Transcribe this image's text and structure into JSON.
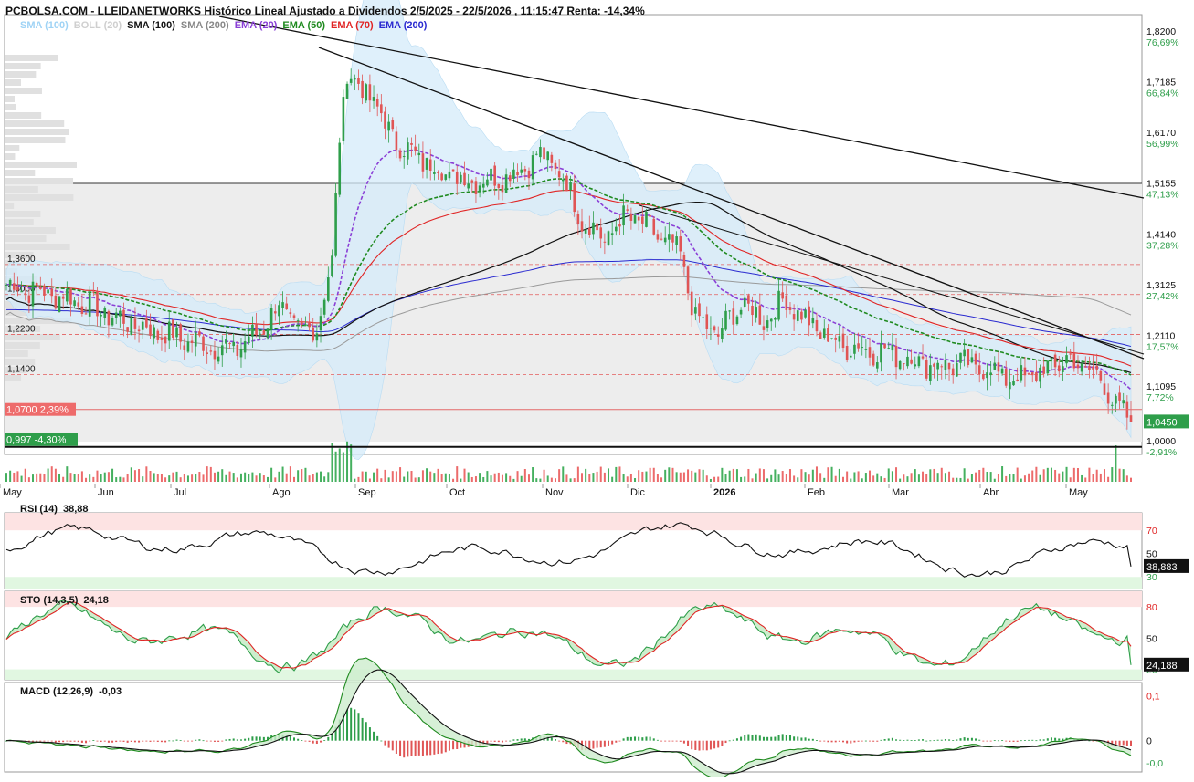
{
  "header": {
    "title": "PCBOLSA.COM - LLEIDANETWORKS Histórico Lineal Ajustado a Dividendos 2/5/2025 - 22/5/2026 , 11:15:47 Renta: -14,34%"
  },
  "legend": [
    {
      "label": "SMA (100)",
      "color": "#9fd3f5"
    },
    {
      "label": "BOLL (20)",
      "color": "#cfcfcf"
    },
    {
      "label": "SMA (100)",
      "color": "#111111"
    },
    {
      "label": "SMA (200)",
      "color": "#888888"
    },
    {
      "label": "EMA (20)",
      "color": "#8a3fd6"
    },
    {
      "label": "EMA (50)",
      "color": "#1f8a1f"
    },
    {
      "label": "EMA (70)",
      "color": "#e02424"
    },
    {
      "label": "EMA (200)",
      "color": "#2a2ad0"
    }
  ],
  "chart_data": [
    {
      "type": "candlestick",
      "panel": "price",
      "x_ticks": [
        "May",
        "Jun",
        "Jul",
        "Ago",
        "Sep",
        "Oct",
        "Nov",
        "Dic",
        "2026",
        "Feb",
        "Mar",
        "Abr",
        "May"
      ],
      "y_ticks": [
        {
          "value": 1.82,
          "label": "1,8200",
          "pct": "76,69%"
        },
        {
          "value": 1.7185,
          "label": "1,7185",
          "pct": "66,84%"
        },
        {
          "value": 1.617,
          "label": "1,6170",
          "pct": "56,99%"
        },
        {
          "value": 1.5155,
          "label": "1,5155",
          "pct": "47,13%"
        },
        {
          "value": 1.414,
          "label": "1,4140",
          "pct": "37,28%"
        },
        {
          "value": 1.3125,
          "label": "1,3125",
          "pct": "27,42%"
        },
        {
          "value": 1.211,
          "label": "1,2110",
          "pct": "17,57%"
        },
        {
          "value": 1.1095,
          "label": "1,1095",
          "pct": "7,72%"
        },
        {
          "value": 1.0,
          "label": "1,0000",
          "pct": "-2,91%"
        }
      ],
      "ylim": [
        0.98,
        1.86
      ],
      "levels": [
        "1,3600",
        "1,3000",
        "1,2200",
        "1,1400"
      ],
      "level_values": [
        1.36,
        1.3,
        1.22,
        1.14
      ],
      "last_price": {
        "label": "1,0450",
        "value": 1.045
      },
      "tag_high": {
        "price": "1,0700",
        "pct": "2,39%",
        "value": 1.07
      },
      "tag_low": {
        "price": "0,997",
        "pct": "-4,30%",
        "value": 0.997
      },
      "ohlc_daily": "generated procedurally from the anchor series below",
      "close_anchors": [
        [
          0,
          1.32
        ],
        [
          18,
          1.29
        ],
        [
          30,
          1.25
        ],
        [
          42,
          1.22
        ],
        [
          52,
          1.2
        ],
        [
          60,
          1.19
        ],
        [
          66,
          1.22
        ],
        [
          72,
          1.28
        ],
        [
          78,
          1.22
        ],
        [
          82,
          1.24
        ],
        [
          86,
          1.36
        ],
        [
          88,
          1.62
        ],
        [
          90,
          1.75
        ],
        [
          92,
          1.72
        ],
        [
          96,
          1.7
        ],
        [
          100,
          1.64
        ],
        [
          105,
          1.59
        ],
        [
          112,
          1.56
        ],
        [
          120,
          1.53
        ],
        [
          128,
          1.53
        ],
        [
          136,
          1.55
        ],
        [
          140,
          1.58
        ],
        [
          146,
          1.55
        ],
        [
          152,
          1.45
        ],
        [
          158,
          1.41
        ],
        [
          164,
          1.46
        ],
        [
          170,
          1.43
        ],
        [
          178,
          1.38
        ],
        [
          182,
          1.25
        ],
        [
          188,
          1.22
        ],
        [
          194,
          1.28
        ],
        [
          200,
          1.25
        ],
        [
          206,
          1.29
        ],
        [
          212,
          1.24
        ],
        [
          220,
          1.2
        ],
        [
          228,
          1.19
        ],
        [
          236,
          1.18
        ],
        [
          244,
          1.16
        ],
        [
          252,
          1.16
        ],
        [
          260,
          1.15
        ],
        [
          266,
          1.13
        ],
        [
          272,
          1.14
        ],
        [
          280,
          1.17
        ],
        [
          286,
          1.15
        ],
        [
          290,
          1.12
        ],
        [
          293,
          1.08
        ],
        [
          296,
          1.05
        ]
      ],
      "overlays": [
        "SMA (100)",
        "SMA (200)",
        "EMA (20)",
        "EMA (50)",
        "EMA (70)",
        "EMA (200)",
        "BOLL (20)"
      ],
      "volume": "shown as green/red bars under price"
    },
    {
      "type": "line",
      "panel": "rsi",
      "title": "RSI (14)",
      "current": "38,88",
      "last_label": "38,883",
      "y_ticks": [
        "70",
        "50",
        "30"
      ],
      "ylim": [
        20,
        85
      ]
    },
    {
      "type": "line",
      "panel": "stochastic",
      "title": "STO (14,3,5)",
      "current": "24,18",
      "last_label": "24,188",
      "y_ticks": [
        "80",
        "50",
        "20"
      ],
      "ylim": [
        10,
        95
      ]
    },
    {
      "type": "line",
      "panel": "macd",
      "title": "MACD (12,26,9)",
      "current": "-0,03",
      "y_ticks": [
        "0,1",
        "0",
        "-0,0"
      ],
      "ylim": [
        -0.07,
        0.13
      ]
    }
  ]
}
